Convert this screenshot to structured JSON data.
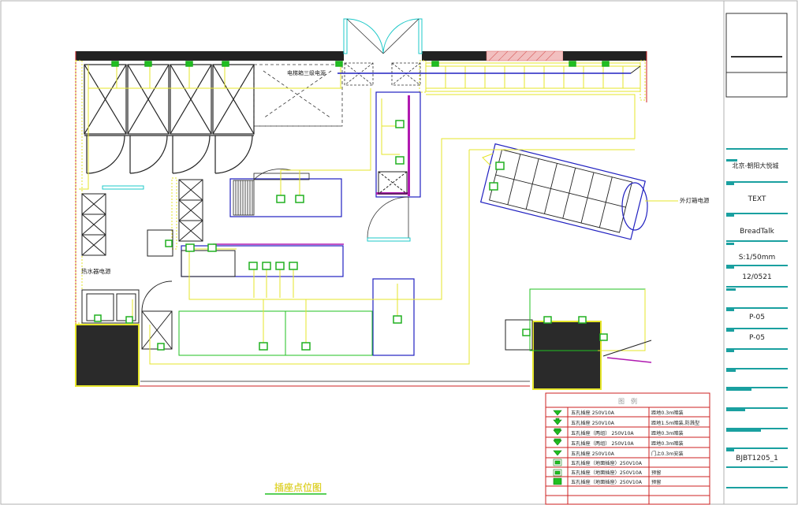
{
  "drawing": {
    "title": "插座点位图",
    "labels": {
      "top_power": "电梯箱三级电源",
      "light_box": "外灯箱电源",
      "water_heater": "热水器电源"
    }
  },
  "title_block": {
    "project": "北京-朝阳大悦城",
    "name": "TEXT",
    "brand": "BreadTalk",
    "scale": "S:1/50mm",
    "date": "12/0521",
    "sheet_a": "P-05",
    "sheet_b": "P-05",
    "code": "BJBT1205_1"
  },
  "legend": {
    "title": "图　例",
    "rows": [
      {
        "name": "五孔插座 250V10A",
        "note": "距地0.3m暗装"
      },
      {
        "name": "五孔插座 250V10A",
        "note": "距地1.5m暗装,防溅型"
      },
      {
        "name": "五孔插座（两组） 250V10A",
        "note": "距地0.3m暗装"
      },
      {
        "name": "五孔插座（两组） 250V10A",
        "note": "距地0.3m暗装"
      },
      {
        "name": "五孔插座 250V10A",
        "note": "门上0.3m安装"
      },
      {
        "name": "五孔插座（地面插座）250V10A",
        "note": ""
      },
      {
        "name": "五孔插座（地面插座）250V10A",
        "note": "预留"
      },
      {
        "name": "五孔插座（地面插座）250V10A",
        "note": "预留"
      }
    ]
  }
}
